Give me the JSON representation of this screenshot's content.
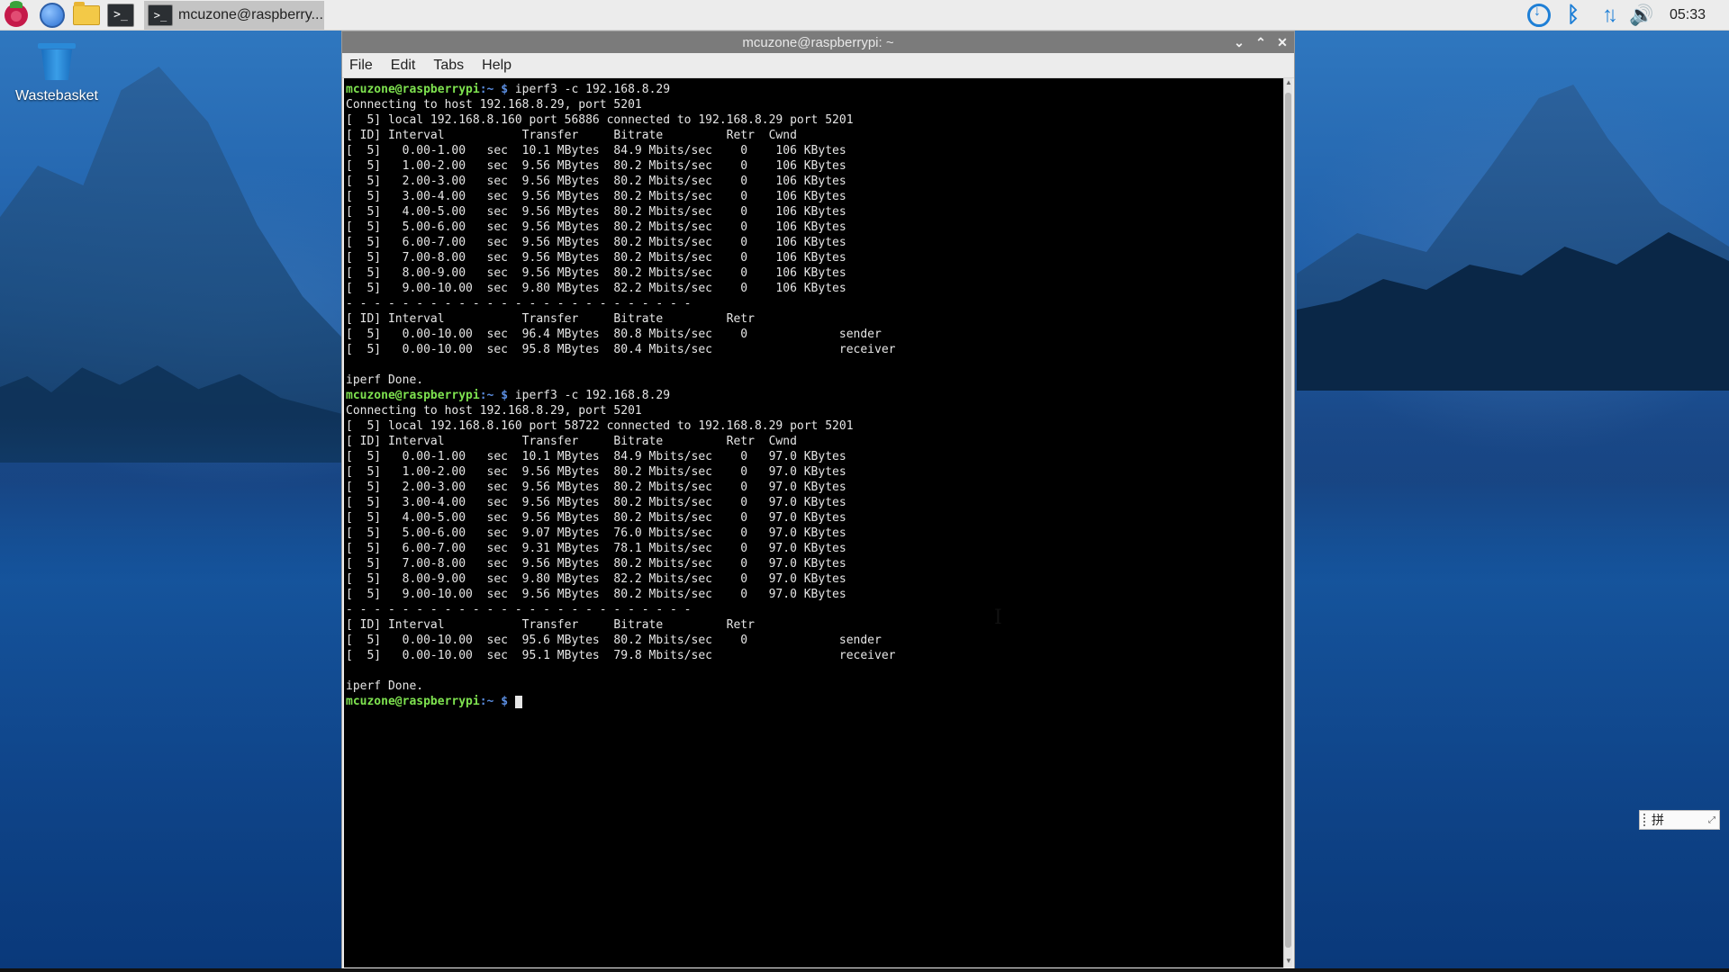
{
  "taskbar": {
    "task_label": "mcuzone@raspberry...",
    "clock": "05:33",
    "terminal_glyph": ">_"
  },
  "desktop": {
    "trash_label": "Wastebasket"
  },
  "window": {
    "title": "mcuzone@raspberrypi: ~",
    "controls": {
      "minimize": "⌄",
      "maximize": "⌃",
      "close": "✕"
    },
    "menu": [
      "File",
      "Edit",
      "Tabs",
      "Help"
    ]
  },
  "terminal": {
    "prompt_user": "mcuzone@raspberrypi",
    "prompt_path": ":~ $ ",
    "lines": [
      {
        "prompt": true,
        "text": "iperf3 -c 192.168.8.29"
      },
      {
        "text": "Connecting to host 192.168.8.29, port 5201"
      },
      {
        "text": "[  5] local 192.168.8.160 port 56886 connected to 192.168.8.29 port 5201"
      },
      {
        "text": "[ ID] Interval           Transfer     Bitrate         Retr  Cwnd"
      },
      {
        "text": "[  5]   0.00-1.00   sec  10.1 MBytes  84.9 Mbits/sec    0    106 KBytes"
      },
      {
        "text": "[  5]   1.00-2.00   sec  9.56 MBytes  80.2 Mbits/sec    0    106 KBytes"
      },
      {
        "text": "[  5]   2.00-3.00   sec  9.56 MBytes  80.2 Mbits/sec    0    106 KBytes"
      },
      {
        "text": "[  5]   3.00-4.00   sec  9.56 MBytes  80.2 Mbits/sec    0    106 KBytes"
      },
      {
        "text": "[  5]   4.00-5.00   sec  9.56 MBytes  80.2 Mbits/sec    0    106 KBytes"
      },
      {
        "text": "[  5]   5.00-6.00   sec  9.56 MBytes  80.2 Mbits/sec    0    106 KBytes"
      },
      {
        "text": "[  5]   6.00-7.00   sec  9.56 MBytes  80.2 Mbits/sec    0    106 KBytes"
      },
      {
        "text": "[  5]   7.00-8.00   sec  9.56 MBytes  80.2 Mbits/sec    0    106 KBytes"
      },
      {
        "text": "[  5]   8.00-9.00   sec  9.56 MBytes  80.2 Mbits/sec    0    106 KBytes"
      },
      {
        "text": "[  5]   9.00-10.00  sec  9.80 MBytes  82.2 Mbits/sec    0    106 KBytes"
      },
      {
        "text": "- - - - - - - - - - - - - - - - - - - - - - - - -"
      },
      {
        "text": "[ ID] Interval           Transfer     Bitrate         Retr"
      },
      {
        "text": "[  5]   0.00-10.00  sec  96.4 MBytes  80.8 Mbits/sec    0             sender"
      },
      {
        "text": "[  5]   0.00-10.00  sec  95.8 MBytes  80.4 Mbits/sec                  receiver"
      },
      {
        "text": ""
      },
      {
        "text": "iperf Done."
      },
      {
        "prompt": true,
        "text": "iperf3 -c 192.168.8.29"
      },
      {
        "text": "Connecting to host 192.168.8.29, port 5201"
      },
      {
        "text": "[  5] local 192.168.8.160 port 58722 connected to 192.168.8.29 port 5201"
      },
      {
        "text": "[ ID] Interval           Transfer     Bitrate         Retr  Cwnd"
      },
      {
        "text": "[  5]   0.00-1.00   sec  10.1 MBytes  84.9 Mbits/sec    0   97.0 KBytes"
      },
      {
        "text": "[  5]   1.00-2.00   sec  9.56 MBytes  80.2 Mbits/sec    0   97.0 KBytes"
      },
      {
        "text": "[  5]   2.00-3.00   sec  9.56 MBytes  80.2 Mbits/sec    0   97.0 KBytes"
      },
      {
        "text": "[  5]   3.00-4.00   sec  9.56 MBytes  80.2 Mbits/sec    0   97.0 KBytes"
      },
      {
        "text": "[  5]   4.00-5.00   sec  9.56 MBytes  80.2 Mbits/sec    0   97.0 KBytes"
      },
      {
        "text": "[  5]   5.00-6.00   sec  9.07 MBytes  76.0 Mbits/sec    0   97.0 KBytes"
      },
      {
        "text": "[  5]   6.00-7.00   sec  9.31 MBytes  78.1 Mbits/sec    0   97.0 KBytes"
      },
      {
        "text": "[  5]   7.00-8.00   sec  9.56 MBytes  80.2 Mbits/sec    0   97.0 KBytes"
      },
      {
        "text": "[  5]   8.00-9.00   sec  9.80 MBytes  82.2 Mbits/sec    0   97.0 KBytes"
      },
      {
        "text": "[  5]   9.00-10.00  sec  9.56 MBytes  80.2 Mbits/sec    0   97.0 KBytes"
      },
      {
        "text": "- - - - - - - - - - - - - - - - - - - - - - - - -"
      },
      {
        "text": "[ ID] Interval           Transfer     Bitrate         Retr"
      },
      {
        "text": "[  5]   0.00-10.00  sec  95.6 MBytes  80.2 Mbits/sec    0             sender"
      },
      {
        "text": "[  5]   0.00-10.00  sec  95.1 MBytes  79.8 Mbits/sec                  receiver"
      },
      {
        "text": ""
      },
      {
        "text": "iperf Done."
      },
      {
        "prompt": true,
        "text": "",
        "cursor": true
      }
    ]
  },
  "ime": {
    "label": "拼"
  },
  "colors": {
    "prompt_user": "#7ee24f",
    "prompt_path": "#5b8de0",
    "terminal_bg": "#000000",
    "terminal_fg": "#e6e6e6",
    "titlebar": "#7b7b7b",
    "tray_accent": "#1e7fd6"
  },
  "icons": [
    "raspberry-pi-menu-icon",
    "web-browser-icon",
    "file-manager-icon",
    "terminal-icon",
    "wastebasket-icon",
    "download-icon",
    "bluetooth-icon",
    "network-icon",
    "volume-icon"
  ]
}
